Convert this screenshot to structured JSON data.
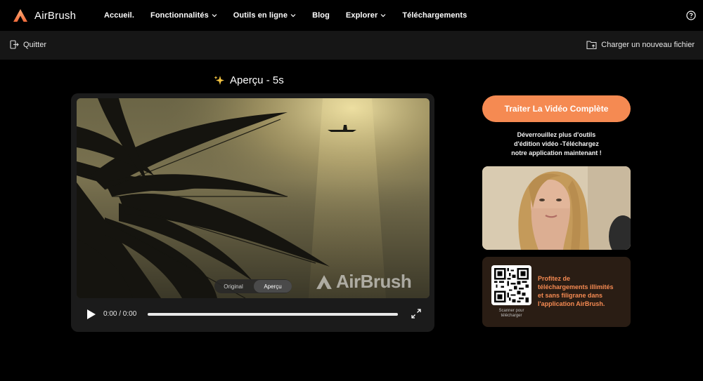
{
  "brand": {
    "name": "AirBrush",
    "accent": "#f58a52"
  },
  "nav": {
    "items": [
      {
        "label": "Accueil.",
        "dropdown": false
      },
      {
        "label": "Fonctionnalités",
        "dropdown": true
      },
      {
        "label": "Outils en ligne",
        "dropdown": true
      },
      {
        "label": "Blog",
        "dropdown": false
      },
      {
        "label": "Explorer",
        "dropdown": true
      },
      {
        "label": "Téléchargements",
        "dropdown": false
      }
    ],
    "help_icon": "question-circle-icon"
  },
  "toolbar": {
    "quit_label": "Quitter",
    "upload_label": "Charger un nouveau fichier"
  },
  "preview": {
    "title": "Aperçu - 5s",
    "watermark": "AirBrush",
    "toggle": {
      "original": "Original",
      "preview": "Aperçu",
      "selected": "Aperçu"
    },
    "player": {
      "time": "0:00 / 0:00"
    }
  },
  "sidebar": {
    "cta_label": "Traiter La Vidéo Complète",
    "unlock_text": [
      "Déverrouillez plus d'outils",
      "d'édition vidéo -Téléchargez",
      "notre application maintenant !"
    ],
    "qr_caption": [
      "Scanner pour",
      "télécharger"
    ],
    "qr_text": [
      "Profitez de",
      "téléchargements illimités",
      "et sans filigrane dans",
      "l'application AirBrush."
    ]
  }
}
